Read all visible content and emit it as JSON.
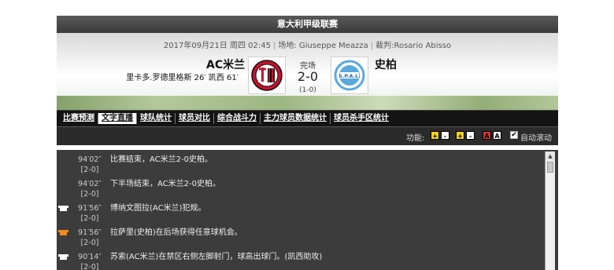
{
  "league": "意大利甲级联赛",
  "match_info": {
    "datetime": "2017年09月21日 周四 02:45",
    "venue": "场地: Giuseppe Meazza",
    "referee": "裁判:Rosario Abisso"
  },
  "home": {
    "name": "AC米兰",
    "scorers": "里卡多.罗德里格斯 26′ 凯西 61′"
  },
  "away": {
    "name": "史柏"
  },
  "status": "完场",
  "score": "2-0",
  "halftime": "(1-0)",
  "tabs": [
    {
      "label": "比赛预测"
    },
    {
      "label": "文字直播"
    },
    {
      "label": "球队统计"
    },
    {
      "label": "球员对比"
    },
    {
      "label": "综合战斗力"
    },
    {
      "label": "主力球员数据统计"
    },
    {
      "label": "球员杀手区统计"
    }
  ],
  "toolbar": {
    "func_label": "功能:",
    "buttons": [
      "+",
      "-",
      "+",
      "-",
      "A",
      "A"
    ],
    "auto_scroll_label": "自动滚动"
  },
  "events": [
    {
      "time": "94′02″",
      "period": "[2-0]",
      "text": "比赛结束，AC米兰2-0史柏。",
      "team": ""
    },
    {
      "time": "94′02″",
      "period": "[2-0]",
      "text": "下半场结束，AC米兰2-0史柏。",
      "team": ""
    },
    {
      "time": "91′56″",
      "period": "[2-0]",
      "text": "博纳文图拉(AC米兰)犯规。",
      "team": "home"
    },
    {
      "time": "91′56″",
      "period": "[2-0]",
      "text": "拉萨里(史柏)在后场获得任意球机会。",
      "team": "away"
    },
    {
      "time": "90′14″",
      "period": "[2-0]",
      "text": "苏索(AC米兰)在禁区右侧左脚射门，球高出球门。(凯西助攻)",
      "team": "home"
    }
  ],
  "colors": {
    "home_shirt": "#ffffff",
    "away_shirt": "#f08b1c",
    "league_bar": "#4a4a4a"
  }
}
